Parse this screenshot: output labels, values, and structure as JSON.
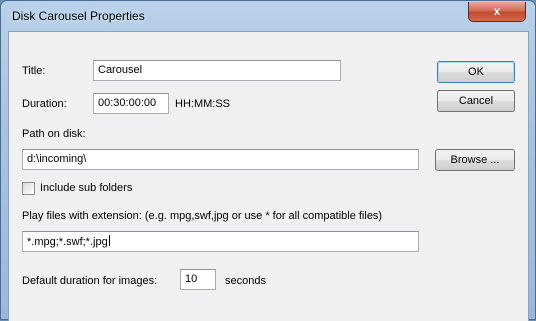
{
  "window": {
    "title": "Disk Carousel Properties",
    "close_glyph": "x"
  },
  "form": {
    "title_label": "Title:",
    "title_value": "Carousel",
    "duration_label": "Duration:",
    "duration_value": "00:30:00:00",
    "duration_format": "HH:MM:SS",
    "path_label": "Path on disk:",
    "path_value": "d:\\incoming\\",
    "include_sub_label": "Include sub folders",
    "include_sub_checked": false,
    "extension_label": "Play files with extension: (e.g. mpg,swf,jpg or use * for all compatible files)",
    "extension_value": "*.mpg;*.swf;*.jpg",
    "image_duration_label": "Default duration for images:",
    "image_duration_value": "10",
    "image_duration_unit": "seconds"
  },
  "buttons": {
    "ok": "OK",
    "cancel": "Cancel",
    "browse": "Browse ..."
  }
}
